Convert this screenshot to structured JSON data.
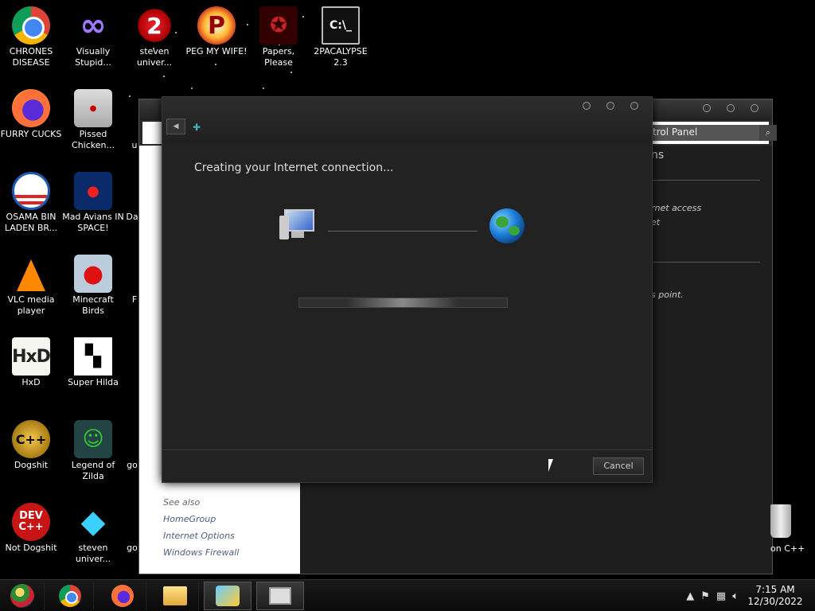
{
  "desktop_icons": [
    {
      "label": "CHRONES DISEASE",
      "icon": "chrome-icon"
    },
    {
      "label": "Visually Stupid...",
      "icon": "visual-studio-icon"
    },
    {
      "label": "steven univer...",
      "icon": "steven-universe-icon"
    },
    {
      "label": "PEG MY WIFE!",
      "icon": "peggle-icon"
    },
    {
      "label": "Papers, Please",
      "icon": "papers-please-icon"
    },
    {
      "label": "2PACALYPSE 2.3",
      "icon": "command-prompt-icon"
    },
    {
      "label": "FURRY CUCKS",
      "icon": "firefox-icon"
    },
    {
      "label": "Pissed Chicken...",
      "icon": "angry-birds-seasons-icon"
    },
    {
      "label": "OSAMA BIN LADEN BR...",
      "icon": "obama-logo-icon"
    },
    {
      "label": "Mad Avians IN SPACE!",
      "icon": "angry-birds-space-icon"
    },
    {
      "label": "VLC media player",
      "icon": "vlc-cone-icon"
    },
    {
      "label": "Minecraft Birds",
      "icon": "angry-birds-icon"
    },
    {
      "label": "HxD",
      "icon": "hxd-icon"
    },
    {
      "label": "Super Hilda",
      "icon": "hilda-icon"
    },
    {
      "label": "Dogshit",
      "icon": "codeblocks-icon"
    },
    {
      "label": "Legend of Zilda",
      "icon": "zelda-character-icon"
    },
    {
      "label": "Not Dogshit",
      "icon": "dev-cpp-icon"
    },
    {
      "label": "steven univer...",
      "icon": "diamond-icon"
    }
  ],
  "partial_labels": {
    "da": "Da",
    "f": "F",
    "go1": "go",
    "go2": "go",
    "u": "u"
  },
  "control_panel": {
    "search_text": "trol Panel",
    "heading_fragment": "ns",
    "text_internet_access": "rnet access",
    "text_et": "et",
    "text_point": "s point.",
    "see_also": "See also",
    "links": [
      "HomeGroup",
      "Internet Options",
      "Windows Firewall"
    ]
  },
  "dialog": {
    "heading": "Creating your Internet connection...",
    "cancel_label": "Cancel",
    "progress_indeterminate": true
  },
  "recycle_bin": {
    "label": "on C++"
  },
  "taskbar": {
    "clock_time": "7:15 AM",
    "clock_date": "12/30/2022",
    "show_hidden": "▲"
  },
  "colors": {
    "desktop": "#000000",
    "dialog_bg": "#222222",
    "link": "#4a5e82"
  }
}
